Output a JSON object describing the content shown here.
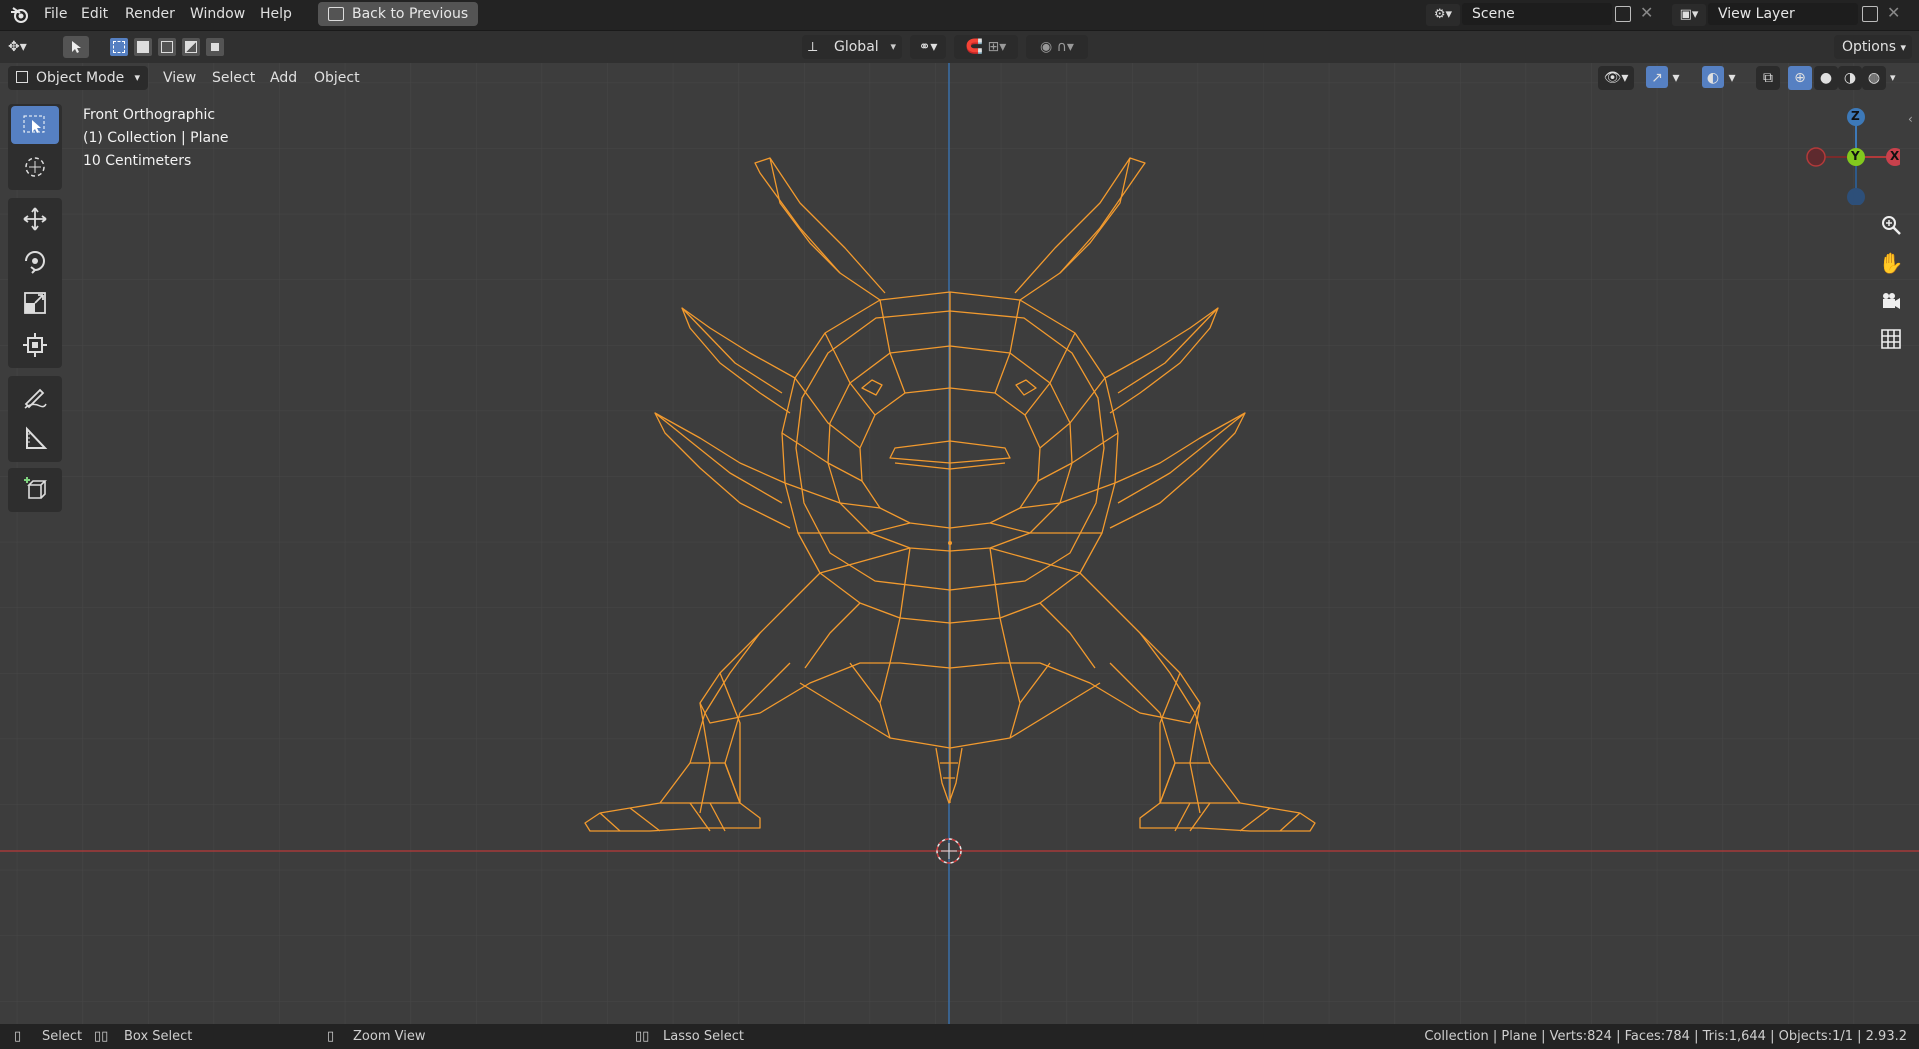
{
  "topbar": {
    "menus": [
      "File",
      "Edit",
      "Render",
      "Window",
      "Help"
    ],
    "back_button": "Back to Previous",
    "scene_label": "Scene",
    "view_layer_label": "View Layer"
  },
  "header": {
    "orientation": "Global",
    "options": "Options"
  },
  "viewport_header": {
    "mode": "Object Mode",
    "menus": [
      "View",
      "Select",
      "Add",
      "Object"
    ]
  },
  "overlay": {
    "view_name": "Front Orthographic",
    "collection": "(1) Collection | Plane",
    "scale": "10 Centimeters"
  },
  "gizmo": {
    "z": "Z",
    "y": "Y",
    "x": "X"
  },
  "statusbar": {
    "select": "Select",
    "box_select": "Box Select",
    "zoom_view": "Zoom View",
    "lasso_select": "Lasso Select",
    "stats": "Collection | Plane | Verts:824 | Faces:784 | Tris:1,644 | Objects:1/1 | 2.93.2"
  },
  "colors": {
    "wire": "#f29a2e",
    "x_axis": "#b23a3a",
    "z_axis": "#3d79b8",
    "selected_tool": "#5680c2"
  }
}
